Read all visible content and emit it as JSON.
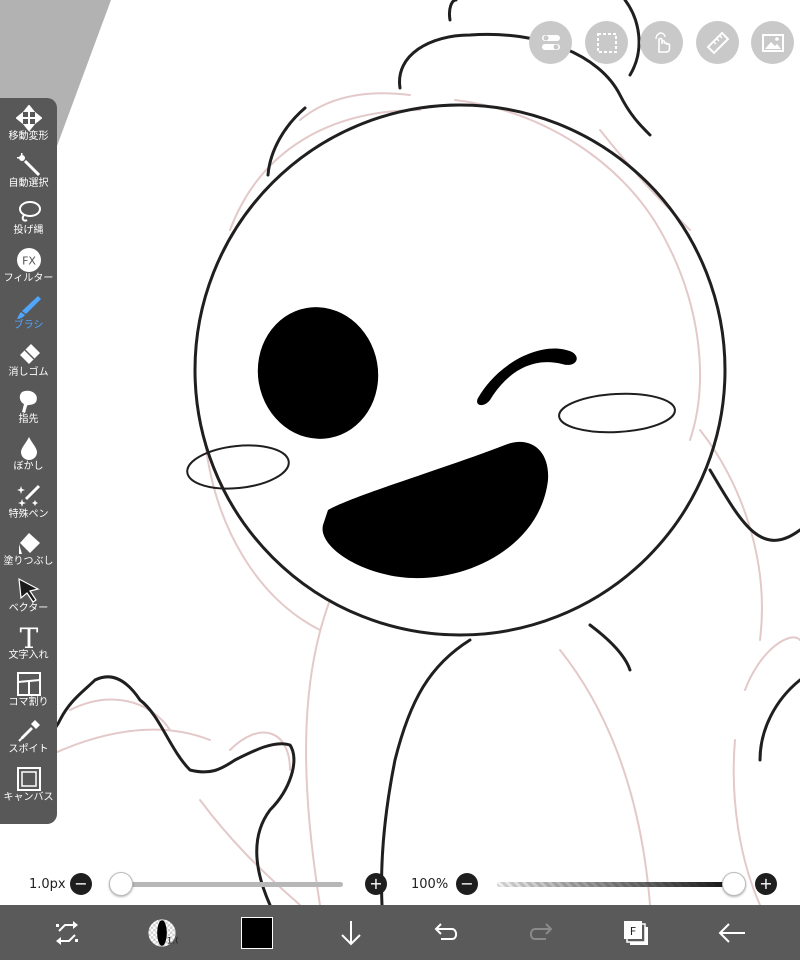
{
  "toolbar": {
    "items": [
      {
        "label": "移動変形",
        "icon": "move-transform-icon"
      },
      {
        "label": "自動選択",
        "icon": "magic-wand-icon"
      },
      {
        "label": "投げ縄",
        "icon": "lasso-icon"
      },
      {
        "label": "フィルター",
        "icon": "fx-filter-icon"
      },
      {
        "label": "ブラシ",
        "icon": "brush-icon"
      },
      {
        "label": "消しゴム",
        "icon": "eraser-icon"
      },
      {
        "label": "指先",
        "icon": "smudge-finger-icon"
      },
      {
        "label": "ぼかし",
        "icon": "blur-drop-icon"
      },
      {
        "label": "特殊ペン",
        "icon": "special-pen-icon"
      },
      {
        "label": "塗りつぶし",
        "icon": "fill-bucket-icon"
      },
      {
        "label": "ベクター",
        "icon": "vector-cursor-icon"
      },
      {
        "label": "文字入れ",
        "icon": "text-icon"
      },
      {
        "label": "コマ割り",
        "icon": "frame-divider-icon"
      },
      {
        "label": "スポイト",
        "icon": "eyedropper-icon"
      },
      {
        "label": "キャンバス",
        "icon": "canvas-icon"
      }
    ],
    "active_label": "ブラシ",
    "active_color": "#4fa6ff"
  },
  "top_buttons": [
    "toggle-icon",
    "selection-icon",
    "touch-gesture-icon",
    "ruler-icon",
    "image-icon"
  ],
  "fx_text": "FX",
  "text_tool_glyph": "T",
  "brush": {
    "size_label": "1.0px",
    "size_fraction": 0.0
  },
  "opacity": {
    "label": "100%",
    "fraction": 1.0
  },
  "bottom_bar": {
    "buttons": [
      "transform-arrows-icon",
      "brush-size-preview-icon",
      "color-swatch",
      "download-arrow-icon",
      "undo-icon",
      "redo-icon",
      "layers-icon",
      "back-arrow-icon"
    ],
    "brush_preview_value": "1.0",
    "current_color": "#000000",
    "layer_badge": "F",
    "redo_enabled": false
  },
  "colors": {
    "bar": "#5a5a5a",
    "panel": "#585858",
    "sketch": "#e3c9c9"
  }
}
